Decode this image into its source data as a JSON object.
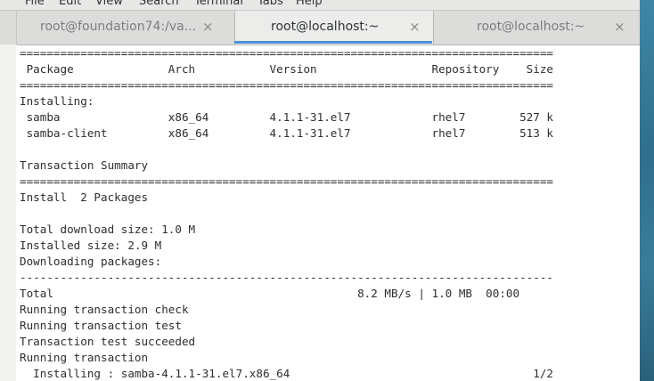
{
  "menu": [
    "File",
    "Edit",
    "View",
    "Search",
    "Terminal",
    "Tabs",
    "Help"
  ],
  "tabs": [
    {
      "label": "root@foundation74:/va...",
      "close": "×",
      "active": false
    },
    {
      "label": "root@localhost:~",
      "close": "×",
      "active": true
    },
    {
      "label": "root@localhost:~",
      "close": "×",
      "active": false
    }
  ],
  "terminal": {
    "lines": [
      "===============================================================================",
      " Package              Arch           Version                 Repository    Size",
      "===============================================================================",
      "Installing:",
      " samba                x86_64         4.1.1-31.el7            rhel7        527 k",
      " samba-client         x86_64         4.1.1-31.el7            rhel7        513 k",
      "",
      "Transaction Summary",
      "===============================================================================",
      "Install  2 Packages",
      "",
      "Total download size: 1.0 M",
      "Installed size: 2.9 M",
      "Downloading packages:",
      "-------------------------------------------------------------------------------",
      "Total                                             8.2 MB/s | 1.0 MB  00:00",
      "Running transaction check",
      "Running transaction test",
      "Transaction test succeeded",
      "Running transaction",
      "  Installing : samba-4.1.1-31.el7.x86_64                                    1/2"
    ]
  },
  "colors": {
    "accent": "#4a90d9",
    "terminal_bg": "#ffffff",
    "terminal_fg": "#2e2e2e"
  }
}
